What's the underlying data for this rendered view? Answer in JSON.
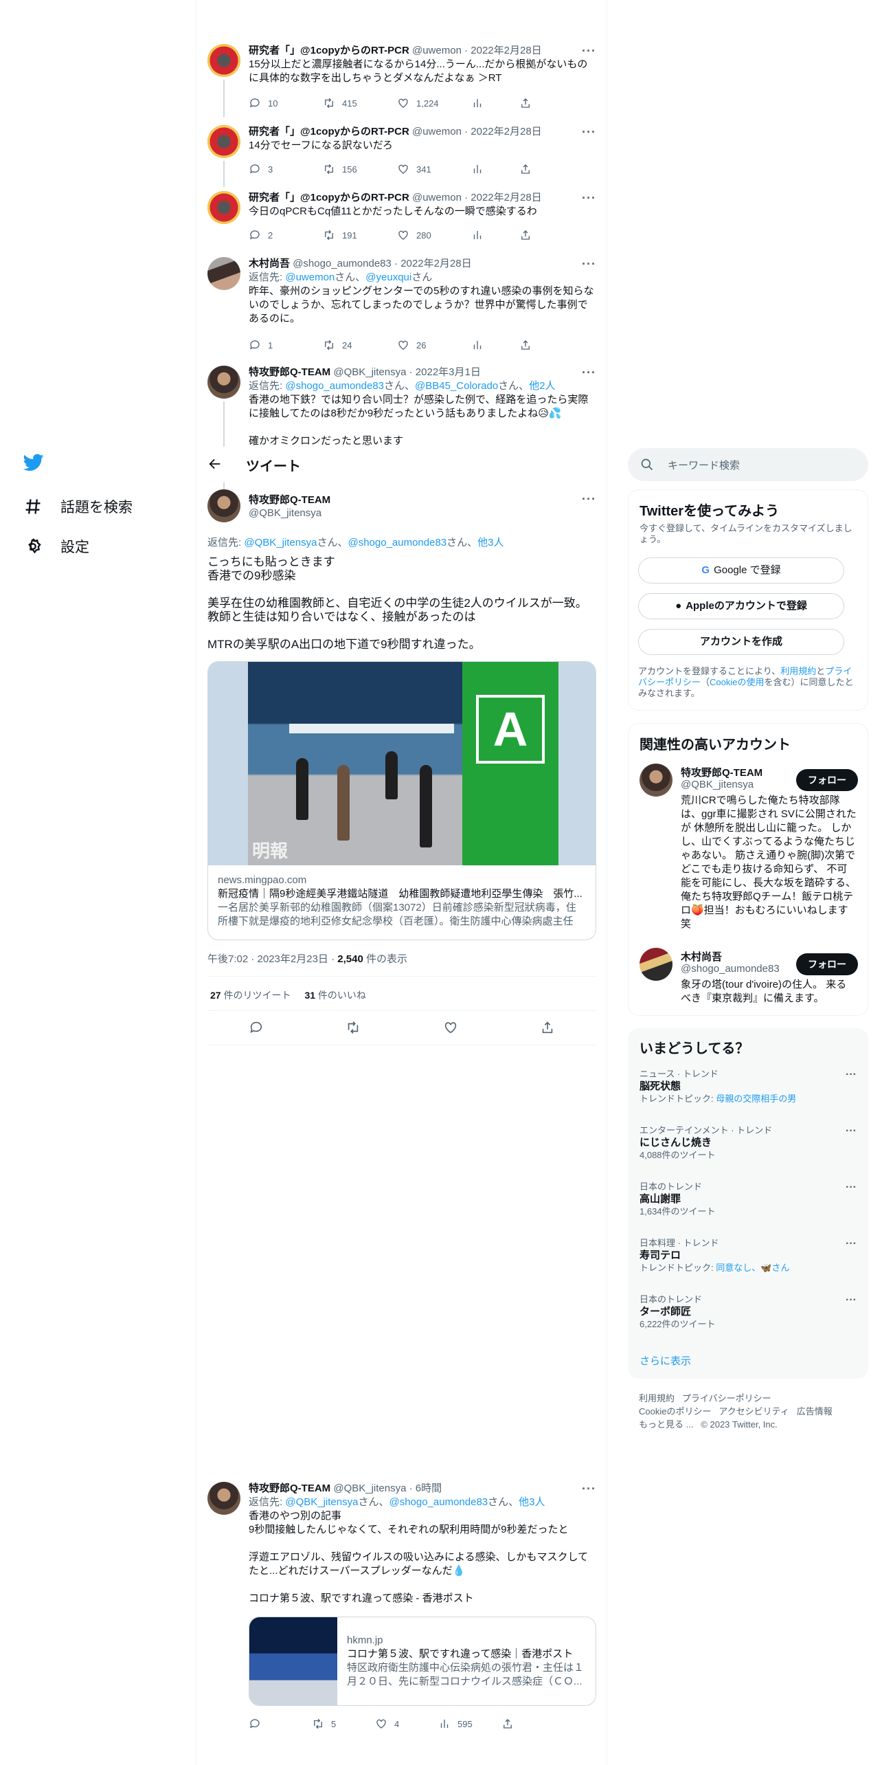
{
  "nav": {
    "explore_label": "話題を検索",
    "settings_label": "設定"
  },
  "header": {
    "title": "ツイート"
  },
  "thread": [
    {
      "name": "研究者「」@1copyからのRT-PCR",
      "handle": "@uwemon",
      "date": "2022年2月28日",
      "text": "15分以上だと濃厚接触者になるから14分...うーん...だから根拠がないものに具体的な数字を出しちゃうとダメなんだよなぁ ＞RT",
      "replies": "10",
      "retweets": "415",
      "likes": "1,224"
    },
    {
      "name": "研究者「」@1copyからのRT-PCR",
      "handle": "@uwemon",
      "date": "2022年2月28日",
      "text": "14分でセーフになる訳ないだろ",
      "replies": "3",
      "retweets": "156",
      "likes": "341"
    },
    {
      "name": "研究者「」@1copyからのRT-PCR",
      "handle": "@uwemon",
      "date": "2022年2月28日",
      "text": "今日のqPCRもCq値11とかだったしそんなの一瞬で感染するわ",
      "replies": "2",
      "retweets": "191",
      "likes": "280"
    },
    {
      "name": "木村尚吾",
      "handle": "@shogo_aumonde83",
      "date": "2022年2月28日",
      "reply_prefix": "返信先: ",
      "reply_to_1": "@uwemon",
      "reply_mid": "さん、",
      "reply_to_2": "@yeuxqui",
      "reply_suffix": "さん",
      "text": "昨年、豪州のショッピングセンターでの5秒のすれ違い感染の事例を知らないのでしょうか、忘れてしまったのでしょうか？世界中が驚愕した事例であるのに。",
      "replies": "1",
      "retweets": "24",
      "likes": "26"
    },
    {
      "name": "特攻野郎Q-TEAM",
      "handle": "@QBK_jitensya",
      "date": "2022年3月1日",
      "reply_prefix": "返信先: ",
      "reply_to_1": "@shogo_aumonde83",
      "reply_mid": "さん、",
      "reply_to_2": "@BB45_Colorado",
      "reply_suffix": "さん、",
      "reply_others": "他2人",
      "text": "香港の地下鉄？では知り合い同士？が感染した例で、経路を追ったら実際に接触してたのは8秒だか9秒だったという話もありましたよね😥💦",
      "text2": "確かオミクロンだったと思います"
    }
  ],
  "main_tweet": {
    "name": "特攻野郎Q-TEAM",
    "handle": "@QBK_jitensya",
    "reply_prefix": "返信先: ",
    "reply_to_1": "@QBK_jitensya",
    "reply_mid": "さん、",
    "reply_to_2": "@shogo_aumonde83",
    "reply_suffix": "さん、",
    "reply_others": "他3人",
    "text": "こっちにも貼っときます\n香港での9秒感染\n\n美孚在住の幼稚園教師と、自宅近くの中学の生徒2人のウイルスが一致。\n教師と生徒は知り合いではなく、接触があったのは\n\nMTRの美孚駅のA出口の地下道で9秒間すれ違った。",
    "card": {
      "image_letter": "A",
      "watermark": "明報",
      "domain": "news.mingpao.com",
      "title": "新冠疫情｜隔9秒途經美孚港鐵站隧道　幼稚園教師疑遭地利亞學生傳染　張竹...",
      "desc": "一名居於美孚新邨的幼稚園教師（個案13072）日前確診感染新型冠狀病毒，住所樓下就是爆疫的地利亞修女紀念學校（百老匯）。衛生防護中心傳染病處主任張..."
    },
    "time": "午後7:02 · 2023年2月23日 · ",
    "views_count": "2,540",
    "views_label": " 件の表示",
    "retweets_count": "27",
    "retweets_label": " 件のリツイート",
    "likes_count": "31",
    "likes_label": " 件のいいね"
  },
  "reply_tweet": {
    "name": "特攻野郎Q-TEAM",
    "handle": "@QBK_jitensya",
    "date": "6時間",
    "reply_prefix": "返信先: ",
    "reply_to_1": "@QBK_jitensya",
    "reply_mid": "さん、",
    "reply_to_2": "@shogo_aumonde83",
    "reply_suffix": "さん、",
    "reply_others": "他3人",
    "text": "香港のやつ別の記事\n9秒間接触したんじゃなくて、それぞれの駅利用時間が9秒差だったと\n\n浮遊エアロゾル、残留ウイルスの吸い込みによる感染、しかもマスクしてたと...どれだけスーパースプレッダーなんだ💧\n\nコロナ第５波、駅ですれ違って感染 - 香港ポスト",
    "card": {
      "domain": "hkmn.jp",
      "title": "コロナ第５波、駅ですれ違って感染｜香港ポスト",
      "desc": "特区政府衛生防護中心伝染病処の張竹君・主任は１月２０日、先に新型コロナウイルス感染症（ＣＯ..."
    },
    "retweets": "5",
    "likes": "4",
    "views": "595"
  },
  "right": {
    "search_placeholder": "キーワード検索",
    "signup": {
      "title": "Twitterを使ってみよう",
      "subtitle": "今すぐ登録して、タイムラインをカスタマイズしましょう。",
      "google_btn": "Google で登録",
      "apple_btn": "Appleのアカウントで登録",
      "create_btn": "アカウントを作成",
      "legal_1": "アカウントを登録することにより、",
      "legal_terms": "利用規約",
      "legal_2": "と",
      "legal_privacy": "プライバシーポリシー",
      "legal_3": "（",
      "legal_cookie": "Cookieの使用",
      "legal_4": "を含む）に同意したとみなされます。"
    },
    "related": {
      "title": "関連性の高いアカウント",
      "follow_label": "フォロー",
      "accounts": [
        {
          "name": "特攻野郎Q-TEAM",
          "handle": "@QBK_jitensya",
          "bio": "荒川CRで鳴らした俺たち特攻部隊は、ggr車に撮影され SVに公開されたが 休憩所を脱出し山に籠った。 しかし、山でくすぶってるような俺たちじゃあない。 筋さえ通りゃ腕(脚)次第でどこでも走り抜ける命知らず、 不可能を可能にし、長大な坂を踏砕する、俺たち特攻野郎Qチーム！飯テロ桃テロ🍑担当！おもむろにいいねします笑"
        },
        {
          "name": "木村尚吾",
          "handle": "@shogo_aumonde83",
          "bio": "象牙の塔(tour d'ivoire)の住人。 来るべき『東京裁判』に備えます。"
        }
      ]
    },
    "trends": {
      "title": "いまどうしてる？",
      "items": [
        {
          "meta": "ニュース · トレンド",
          "name": "脳死状態",
          "sub_label": "トレンドトピック: ",
          "sub_link": "母親の交際相手の男"
        },
        {
          "meta": "エンターテインメント · トレンド",
          "name": "にじさんじ焼き",
          "sub_label": "4,088件のツイート",
          "sub_link": ""
        },
        {
          "meta": "日本のトレンド",
          "name": "高山謝罪",
          "sub_label": "1,634件のツイート",
          "sub_link": ""
        },
        {
          "meta": "日本料理 · トレンド",
          "name": "寿司テロ",
          "sub_label": "トレンドトピック: ",
          "sub_link": "同意なし、🦋さん"
        },
        {
          "meta": "日本のトレンド",
          "name": "ターボ師匠",
          "sub_label": "6,222件のツイート",
          "sub_link": ""
        }
      ],
      "show_more": "さらに表示"
    },
    "footer": {
      "terms": "利用規約",
      "privacy": "プライバシーポリシー",
      "cookie": "Cookieのポリシー",
      "accessibility": "アクセシビリティ",
      "ads": "広告情報",
      "more": "もっと見る ...",
      "copyright": "© 2023 Twitter, Inc."
    }
  }
}
